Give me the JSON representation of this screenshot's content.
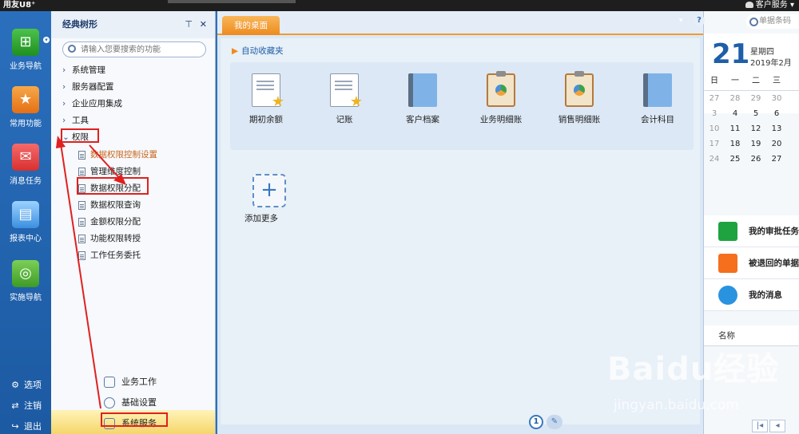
{
  "topbar": {
    "brand": "用友U8⁺",
    "service": "客户服务 ▾"
  },
  "leftnav": {
    "items": [
      {
        "label": "业务导航",
        "icon": "tree-icon"
      },
      {
        "label": "常用功能",
        "icon": "star-icon"
      },
      {
        "label": "消息任务",
        "icon": "message-icon"
      },
      {
        "label": "报表中心",
        "icon": "report-icon"
      },
      {
        "label": "实施导航",
        "icon": "compass-icon"
      }
    ],
    "bottom": [
      {
        "label": "选项",
        "icon": "gear-icon"
      },
      {
        "label": "注销",
        "icon": "logout-icon"
      },
      {
        "label": "退出",
        "icon": "exit-icon"
      }
    ]
  },
  "tree": {
    "title": "经典树形",
    "search_placeholder": "请输入您要搜索的功能",
    "groups": [
      {
        "label": "系统管理"
      },
      {
        "label": "服务器配置"
      },
      {
        "label": "企业应用集成"
      },
      {
        "label": "工具"
      },
      {
        "label": "权限"
      }
    ],
    "leaves": [
      {
        "label": "数据权限控制设置"
      },
      {
        "label": "管理维度控制"
      },
      {
        "label": "数据权限分配"
      },
      {
        "label": "数据权限查询"
      },
      {
        "label": "金额权限分配"
      },
      {
        "label": "功能权限转授"
      },
      {
        "label": "工作任务委托"
      }
    ],
    "bottom": [
      {
        "label": "业务工作"
      },
      {
        "label": "基础设置"
      },
      {
        "label": "系统服务"
      }
    ]
  },
  "main": {
    "tab": "我的桌面",
    "fav_title": "自动收藏夹",
    "favorites": [
      {
        "label": "期初余额",
        "kind": "doc"
      },
      {
        "label": "记账",
        "kind": "doc"
      },
      {
        "label": "客户档案",
        "kind": "book"
      },
      {
        "label": "业务明细账",
        "kind": "clip"
      },
      {
        "label": "销售明细账",
        "kind": "clip"
      },
      {
        "label": "会计科目",
        "kind": "book"
      }
    ],
    "add_more": "添加更多",
    "page": "1"
  },
  "right": {
    "search_placeholder": "单据条码",
    "day": "21",
    "weekday": "星期四",
    "yearmonth": "2019年2月",
    "cal_headers": [
      "日",
      "一",
      "二",
      "三"
    ],
    "cal_rows": [
      [
        "27",
        "28",
        "29",
        "30"
      ],
      [
        "3",
        "4",
        "5",
        "6"
      ],
      [
        "10",
        "11",
        "12",
        "13"
      ],
      [
        "17",
        "18",
        "19",
        "20"
      ],
      [
        "24",
        "25",
        "26",
        "27"
      ]
    ],
    "tasks": [
      {
        "label": "我的审批任务"
      },
      {
        "label": "被退回的单据"
      },
      {
        "label": "我的消息"
      }
    ],
    "name_col": "名称"
  },
  "watermark": {
    "line1": "Baidu经验",
    "line2": "jingyan.baidu.com"
  },
  "colors": {
    "accent": "#2f6fb4",
    "tab": "#ee8a1d",
    "annotation": "#e02020"
  }
}
